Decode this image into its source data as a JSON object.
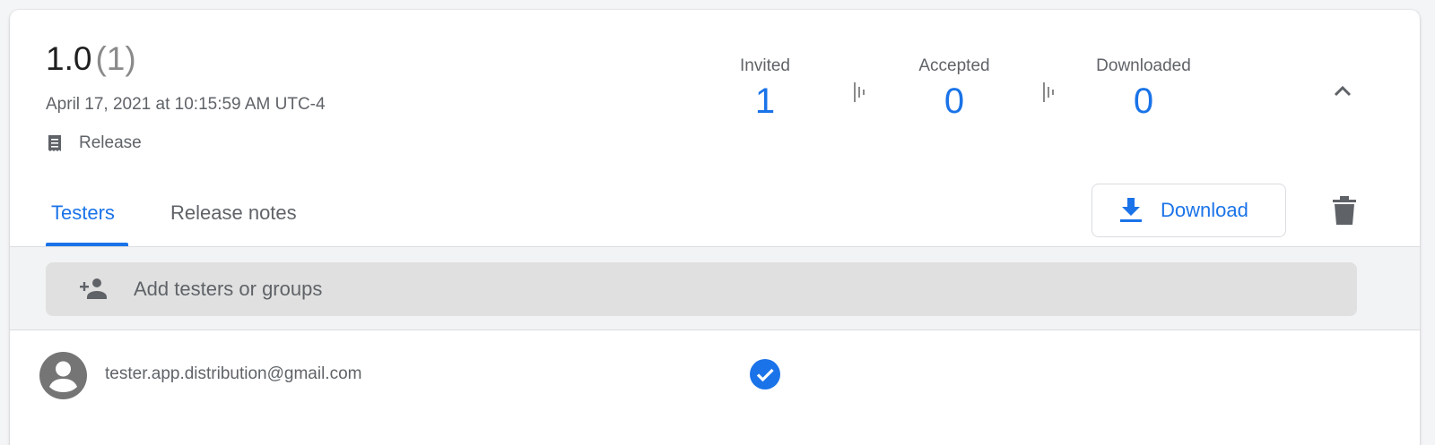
{
  "release": {
    "version": "1.0",
    "build": "(1)",
    "date": "April 17, 2021 at 10:15:59 AM UTC-4",
    "type_label": "Release",
    "type_icon": "release-notes-icon"
  },
  "stats": [
    {
      "label": "Invited",
      "value": "1"
    },
    {
      "label": "Accepted",
      "value": "0"
    },
    {
      "label": "Downloaded",
      "value": "0"
    }
  ],
  "tabs": [
    {
      "label": "Testers",
      "active": true
    },
    {
      "label": "Release notes",
      "active": false
    }
  ],
  "actions": {
    "download_label": "Download",
    "download_icon": "download-icon",
    "delete_icon": "delete-icon",
    "collapse_icon": "chevron-up-icon"
  },
  "add_testers": {
    "placeholder": "Add testers or groups",
    "icon": "person-add-icon"
  },
  "testers": [
    {
      "email": "tester.app.distribution@gmail.com",
      "accepted": true
    }
  ],
  "colors": {
    "accent": "#1a73e8",
    "text_secondary": "#5f6368",
    "input_bg": "#e0e0e0"
  }
}
